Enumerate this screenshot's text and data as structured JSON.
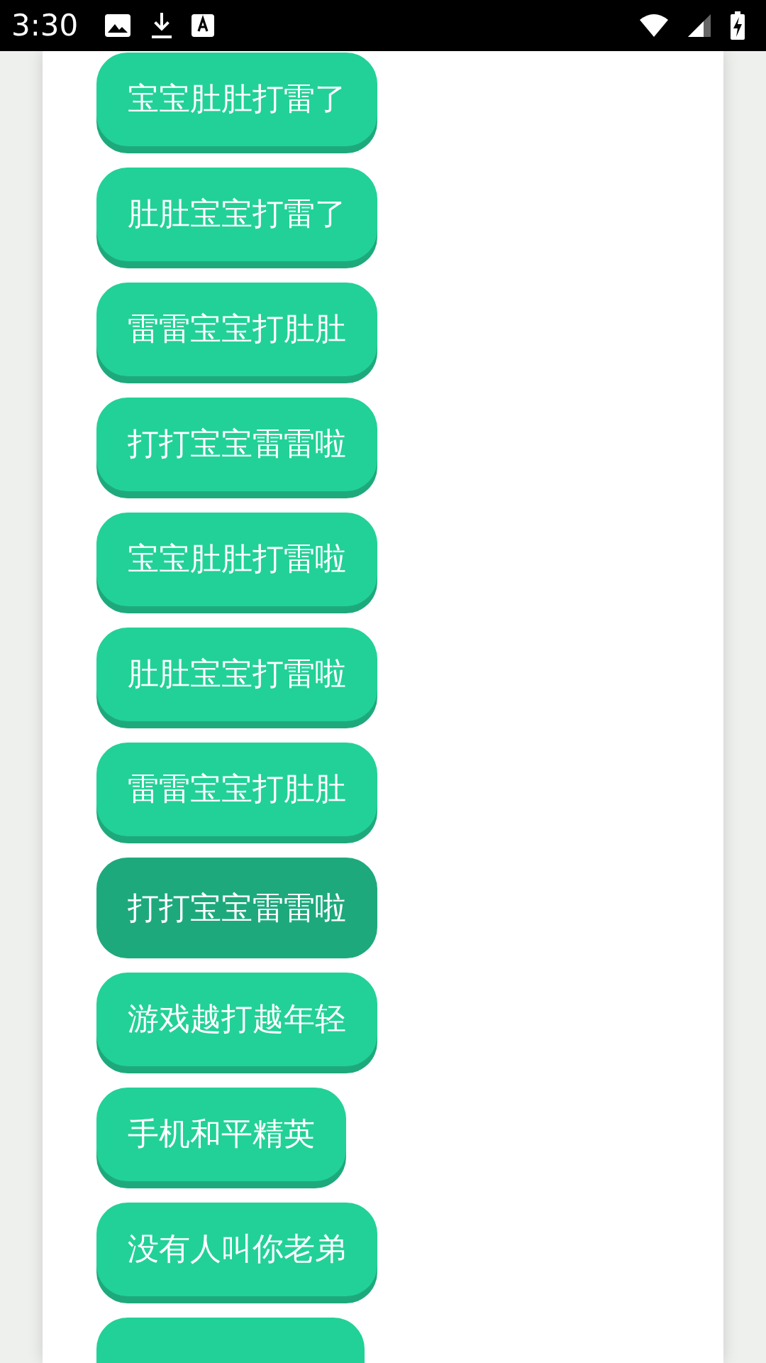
{
  "status_bar": {
    "time": "3:30"
  },
  "buttons": [
    {
      "label": "宝宝肚肚打雷了",
      "pressed": false
    },
    {
      "label": "肚肚宝宝打雷了",
      "pressed": false
    },
    {
      "label": "雷雷宝宝打肚肚",
      "pressed": false
    },
    {
      "label": "打打宝宝雷雷啦",
      "pressed": false
    },
    {
      "label": "宝宝肚肚打雷啦",
      "pressed": false
    },
    {
      "label": "肚肚宝宝打雷啦",
      "pressed": false
    },
    {
      "label": "雷雷宝宝打肚肚",
      "pressed": false
    },
    {
      "label": "打打宝宝雷雷啦",
      "pressed": true
    },
    {
      "label": "游戏越打越年轻",
      "pressed": false
    },
    {
      "label": "手机和平精英",
      "pressed": false
    },
    {
      "label": "没有人叫你老弟",
      "pressed": false
    },
    {
      "pressed": false
    }
  ]
}
